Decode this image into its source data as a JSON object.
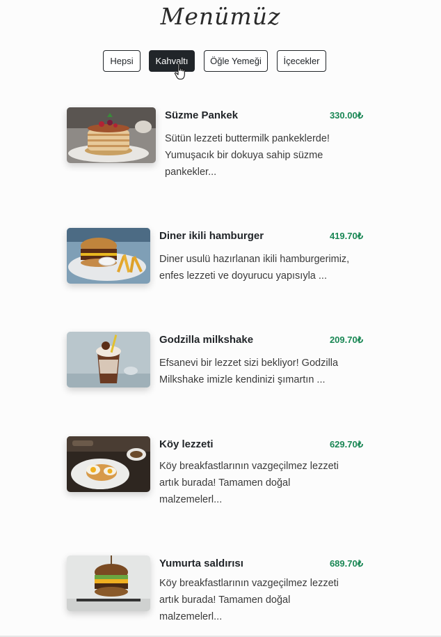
{
  "page": {
    "title": "Menümüz"
  },
  "filters": [
    {
      "label": "Hepsi",
      "active": false
    },
    {
      "label": "Kahvaltı",
      "active": true
    },
    {
      "label": "Öğle Yemeği",
      "active": false
    },
    {
      "label": "İçecekler",
      "active": false
    }
  ],
  "items": [
    {
      "name": "Süzme Pankek",
      "price": "330.00₺",
      "description": "Sütün lezzeti buttermilk pankeklerde! Yumuşacık bir dokuya sahip süzme pankekler...",
      "image": "pancake-stack-photo"
    },
    {
      "name": "Diner ikili hamburger",
      "price": "419.70₺",
      "description": "Diner usulü hazırlanan ikili hamburgerimiz, enfes lezzeti ve doyurucu yapısıyla ...",
      "image": "burger-fries-photo"
    },
    {
      "name": "Godzilla milkshake",
      "price": "209.70₺",
      "description": "Efsanevi bir lezzet sizi bekliyor! Godzilla Milkshake imizle kendinizi şımartın ...",
      "image": "milkshake-photo"
    },
    {
      "name": "Köy lezzeti",
      "price": "629.70₺",
      "description": "Köy breakfastlarının vazgeçilmez lezzeti artık burada! Tamamen doğal malzemelerl...",
      "image": "village-breakfast-photo"
    },
    {
      "name": "Yumurta saldırısı",
      "price": "689.70₺",
      "description": "Köy breakfastlarının vazgeçilmez lezzeti artık burada! Tamamen doğal malzemelerl...",
      "image": "egg-burger-photo"
    }
  ],
  "colors": {
    "price": "#198754",
    "button_active_bg": "#212529",
    "text": "#212529"
  }
}
